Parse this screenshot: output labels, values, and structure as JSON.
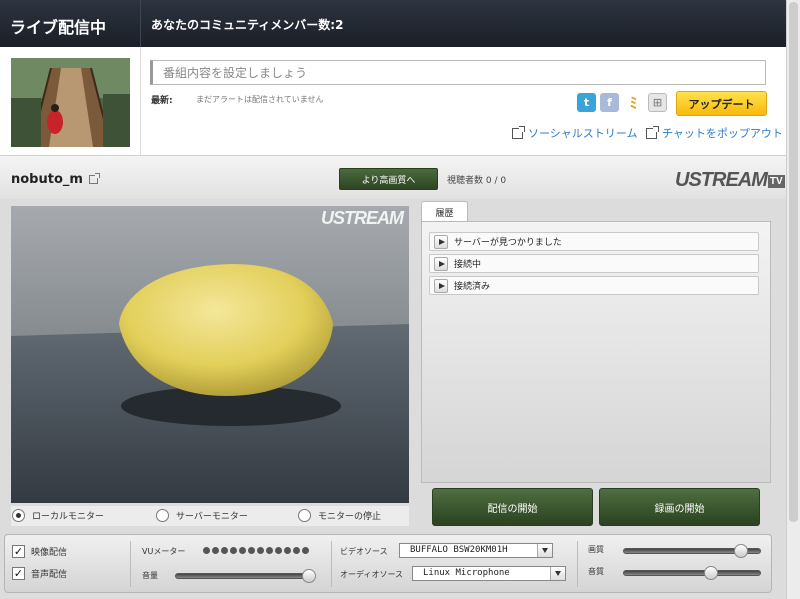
{
  "topbar": {
    "live_label": "ライブ配信中",
    "members_label": "あなたのコミュニティメンバー数:2"
  },
  "header": {
    "program_placeholder": "番組内容を設定しましょう",
    "latest_label": "最新:",
    "latest_text": "まだアラートは配信されていません",
    "update_button": "アップデート",
    "social_stream_link": "ソーシャルストリーム",
    "chat_popout_link": "チャットをポップアウト",
    "social_icons": [
      "twitter-icon",
      "facebook-icon",
      "mixi-icon",
      "other-share-icon"
    ],
    "social_glyphs": {
      "twitter": "t",
      "facebook": "f",
      "mixi": "ﾐ",
      "other": "⊞"
    }
  },
  "channel": {
    "name": "nobuto_m",
    "hq_button": "より高画質へ",
    "viewers_label": "視聴者数 0 / 0",
    "logo": "USTREAM",
    "logo_tv": "TV"
  },
  "video": {
    "watermark": "USTREAM",
    "monitor_options": [
      {
        "label": "ローカルモニター",
        "selected": true
      },
      {
        "label": "サーバーモニター",
        "selected": false
      },
      {
        "label": "モニターの停止",
        "selected": false
      }
    ]
  },
  "history": {
    "tab_label": "履歴",
    "items": [
      "サーバーが見つかりました",
      "接続中",
      "接続済み"
    ]
  },
  "actions": {
    "broadcast_button": "配信の開始",
    "record_button": "録画の開始"
  },
  "controls": {
    "video_checkbox": {
      "label": "映像配信",
      "checked": true
    },
    "audio_checkbox": {
      "label": "音声配信",
      "checked": true
    },
    "vu_label": "VUメーター",
    "volume_label": "音量",
    "video_source_label": "ビデオソース",
    "video_source_value": "BUFFALO BSW20KM01H",
    "audio_source_label": "オーディオソース",
    "audio_source_value": "Linux Microphone",
    "picture_quality_label": "画質",
    "audio_quality_label": "音質"
  },
  "colors": {
    "topbar": "#1a1f27",
    "accent_green": "#2b4220",
    "update_yellow": "#f9b80c",
    "link_blue": "#2a7bd1"
  }
}
